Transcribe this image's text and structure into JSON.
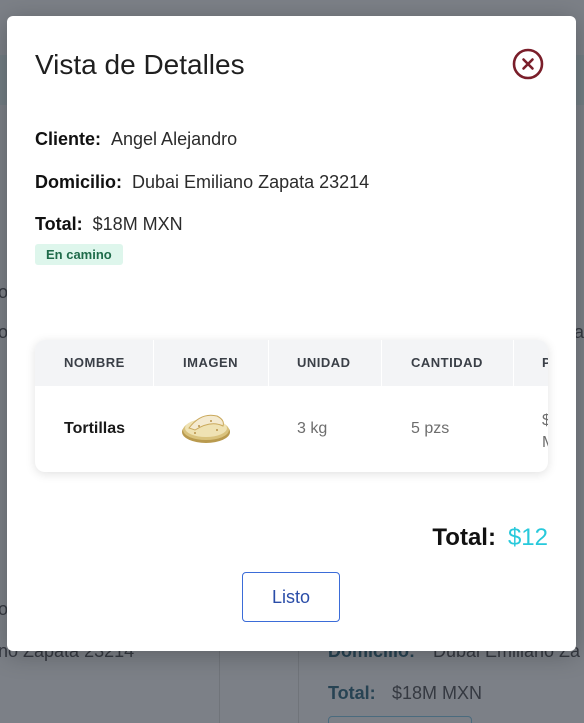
{
  "background": {
    "fragment_left_mid": "o",
    "fragment_left_mid2": "o",
    "fragment_left_low": "o",
    "fragment_right_mid": "a",
    "fragment_address": "no Zapata 23214",
    "domicilio_label": "Domicilio:",
    "domicilio_value": "Dubai Emiliano Za",
    "total_label": "Total:",
    "total_value": "$18M MXN"
  },
  "modal": {
    "title": "Vista de Detalles",
    "close_icon": "close-circle-icon",
    "cliente_label": "Cliente:",
    "cliente_value": "Angel Alejandro",
    "domicilio_label": "Domicilio:",
    "domicilio_value": "Dubai Emiliano Zapata 23214",
    "total_label": "Total:",
    "total_value": "$18M MXN",
    "status": "En camino",
    "status_color": "#1f6b4a",
    "table": {
      "headers": [
        "NOMBRE",
        "IMAGEN",
        "UNIDAD",
        "CANTIDAD",
        "P"
      ],
      "rows": [
        {
          "nombre": "Tortillas",
          "imagen": "tortillas-image",
          "unidad": "3 kg",
          "cantidad": "5 pzs",
          "precio_line1": "$",
          "precio_line2": "M"
        }
      ]
    },
    "grand_total_label": "Total:",
    "grand_total_value": "$12",
    "grand_total_color": "#27c9db",
    "ok_button": "Listo"
  }
}
